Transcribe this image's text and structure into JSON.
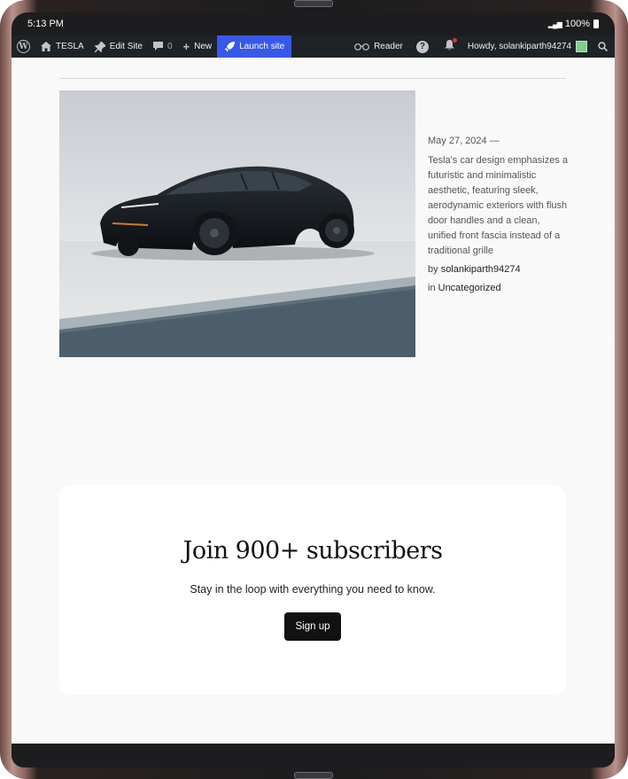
{
  "status_bar": {
    "time": "5:13 PM",
    "battery": "100%"
  },
  "admin_bar": {
    "site_name": "TESLA",
    "edit_site": "Edit Site",
    "comments_count": "0",
    "new_label": "New",
    "launch_label": "Launch site",
    "reader_label": "Reader",
    "howdy": "Howdy, solankiparth94274"
  },
  "post": {
    "date": "May 27, 2024 —",
    "excerpt": "Tesla's car design emphasizes a futuristic and minimalistic aesthetic, featuring sleek, aerodynamic exteriors with flush door handles and a clean, unified front fascia instead of a traditional grille",
    "by_prefix": "by",
    "author": "solankiparth94274",
    "in_prefix": "in",
    "category": "Uncategorized"
  },
  "subscribe": {
    "title": "Join 900+ subscribers",
    "subtitle": "Stay in the loop with everything you need to know.",
    "button_label": "Sign up"
  },
  "colors": {
    "admin_bar_bg": "#1d2327",
    "launch_accent": "#3858e9",
    "button_bg": "#111111",
    "page_bg": "#f9f9f9"
  }
}
